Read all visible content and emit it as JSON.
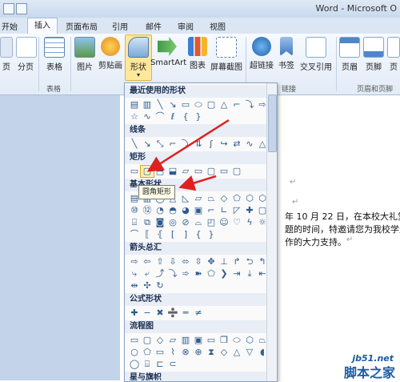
{
  "window": {
    "title": "Word - Microsoft O"
  },
  "tabs": [
    {
      "label": "开始"
    },
    {
      "label": "插入",
      "active": true
    },
    {
      "label": "页面布局"
    },
    {
      "label": "引用"
    },
    {
      "label": "邮件"
    },
    {
      "label": "审阅"
    },
    {
      "label": "视图"
    }
  ],
  "ribbon": {
    "buttons": {
      "page": "页",
      "page_break": "分页",
      "table": "表格",
      "picture": "图片",
      "clipart": "剪贴画",
      "shapes": "形状",
      "smartart": "SmartArt",
      "chart": "图表",
      "screenshot": "屏幕截图",
      "hyperlink": "超链接",
      "bookmark": "书签",
      "crossref": "交叉引用",
      "header": "页眉",
      "footer": "页脚",
      "pagenum": "页"
    },
    "groups": {
      "tables": "表格",
      "links": "链接",
      "header_footer": "页眉和页脚"
    }
  },
  "gallery": {
    "sections": [
      {
        "title": "最近使用的形状"
      },
      {
        "title": "线条"
      },
      {
        "title": "矩形"
      },
      {
        "title": "基本形状"
      },
      {
        "title": "箭头总汇"
      },
      {
        "title": "公式形状"
      },
      {
        "title": "流程图"
      },
      {
        "title": "星与旗帜"
      }
    ],
    "tooltip": "圆角矩形"
  },
  "document": {
    "line1": "年 10 月 22 日，在本校大礼堂举",
    "line2": "题的时间，特邀请您为我校学生",
    "line3": "作的大力支持。"
  },
  "watermark": {
    "site": "jb51.net",
    "brand": "脚本之家"
  }
}
